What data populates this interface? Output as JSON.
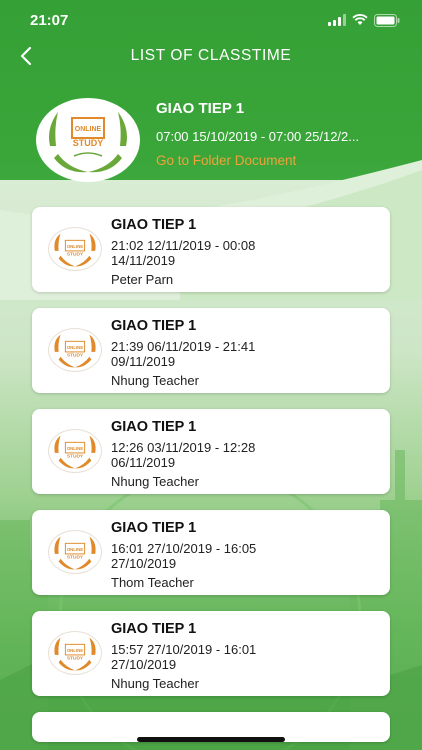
{
  "status_bar": {
    "time": "21:07"
  },
  "nav": {
    "title": "LIST OF CLASSTIME"
  },
  "course": {
    "title": "GIAO TIEP 1",
    "time_range": "07:00 15/10/2019 - 07:00 25/12/2...",
    "folder_link": "Go to Folder Document",
    "logo_text_line1": "ONLINE",
    "logo_text_line2": "STUDY"
  },
  "classes": [
    {
      "title": "GIAO TIEP 1",
      "time": "21:02 12/11/2019 - 00:08 14/11/2019",
      "teacher": "Peter Parn"
    },
    {
      "title": "GIAO TIEP 1",
      "time": "21:39 06/11/2019 - 21:41 09/11/2019",
      "teacher": "Nhung Teacher"
    },
    {
      "title": "GIAO TIEP 1",
      "time": "12:26 03/11/2019 - 12:28 06/11/2019",
      "teacher": "Nhung Teacher"
    },
    {
      "title": "GIAO TIEP 1",
      "time": "16:01 27/10/2019 - 16:05 27/10/2019",
      "teacher": "Thom Teacher"
    },
    {
      "title": "GIAO TIEP 1",
      "time": "15:57 27/10/2019 - 16:01 27/10/2019",
      "teacher": "Nhung Teacher"
    }
  ],
  "colors": {
    "primary": "#3b9f3b",
    "link": "#f0a23a",
    "logo_orange": "#e08a2b",
    "logo_green": "#4a9a3a"
  },
  "icons": {
    "back": "chevron-left-icon",
    "signal": "signal-icon",
    "wifi": "wifi-icon",
    "battery": "battery-icon"
  }
}
